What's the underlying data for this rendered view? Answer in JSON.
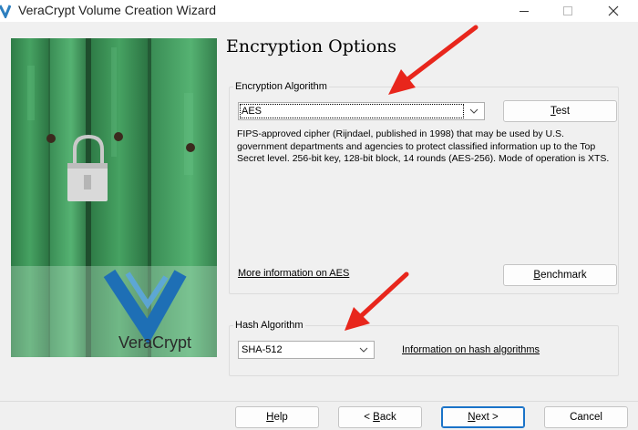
{
  "window": {
    "title": "VeraCrypt Volume Creation Wizard"
  },
  "page": {
    "title": "Encryption Options"
  },
  "brand": {
    "logo_text": "VeraCrypt"
  },
  "encryption": {
    "group_label": "Encryption Algorithm",
    "selected": "AES",
    "test_label_mn": "T",
    "test_label_rest": "est",
    "description": "FIPS-approved cipher (Rijndael, published in 1998) that may be used by U.S. government departments and agencies to protect classified information up to the Top Secret level. 256-bit key, 128-bit block, 14 rounds (AES-256). Mode of operation is XTS.",
    "more_info_link": "More information on AES",
    "benchmark_label_mn": "B",
    "benchmark_label_rest": "enchmark"
  },
  "hash": {
    "group_label": "Hash Algorithm",
    "selected": "SHA-512",
    "info_link": "Information on hash algorithms"
  },
  "footer": {
    "help_mn": "H",
    "help_rest": "elp",
    "back_pre": "< ",
    "back_mn": "B",
    "back_rest": "ack",
    "next_mn": "N",
    "next_rest": "ext >",
    "cancel_label": "Cancel"
  },
  "colors": {
    "accent_focus": "#1a73c8",
    "annotation_arrow": "#e8261c",
    "door_green": "#3f9a5a"
  },
  "icons": {
    "app": "veracrypt-app-icon",
    "minimize": "minimize-icon",
    "maximize": "maximize-icon",
    "close": "close-icon",
    "dropdown": "chevron-down-icon"
  }
}
